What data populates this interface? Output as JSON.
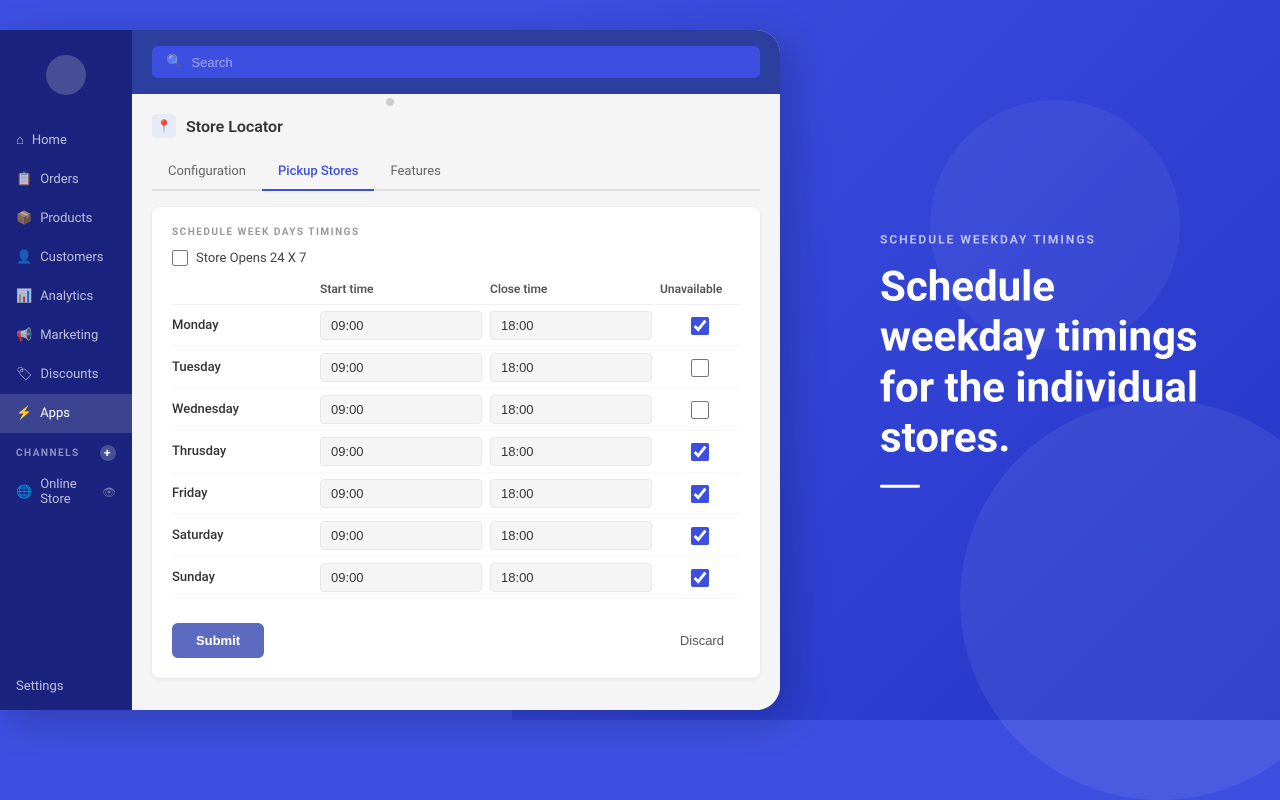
{
  "sidebar": {
    "items": [
      {
        "label": "Home",
        "id": "home"
      },
      {
        "label": "Orders",
        "id": "orders"
      },
      {
        "label": "Products",
        "id": "products"
      },
      {
        "label": "Customers",
        "id": "customers"
      },
      {
        "label": "Analytics",
        "id": "analytics"
      },
      {
        "label": "Marketing",
        "id": "marketing"
      },
      {
        "label": "Discounts",
        "id": "discounts"
      },
      {
        "label": "Apps",
        "id": "apps"
      }
    ],
    "channels_label": "CHANNELS",
    "channel_items": [
      {
        "label": "Online Store",
        "id": "online-store"
      }
    ],
    "settings_label": "Settings"
  },
  "search": {
    "placeholder": "Search"
  },
  "page": {
    "title": "Store Locator",
    "tabs": [
      {
        "label": "Configuration",
        "id": "configuration"
      },
      {
        "label": "Pickup Stores",
        "id": "pickup-stores",
        "active": true
      },
      {
        "label": "Features",
        "id": "features"
      }
    ]
  },
  "form": {
    "section_title": "SCHEDULE WEEK DAYS TIMINGS",
    "checkbox_label": "Store Opens 24 X 7",
    "headers": {
      "day": "",
      "start_time": "Start time",
      "close_time": "Close time",
      "unavailable": "Unavailable"
    },
    "days": [
      {
        "label": "Monday",
        "start": "09:00",
        "close": "18:00",
        "unavailable": true
      },
      {
        "label": "Tuesday",
        "start": "09:00",
        "close": "18:00",
        "unavailable": false
      },
      {
        "label": "Wednesday",
        "start": "09:00",
        "close": "18:00",
        "unavailable": false
      },
      {
        "label": "Thrusday",
        "start": "09:00",
        "close": "18:00",
        "unavailable": true
      },
      {
        "label": "Friday",
        "start": "09:00",
        "close": "18:00",
        "unavailable": true
      },
      {
        "label": "Saturday",
        "start": "09:00",
        "close": "18:00",
        "unavailable": true
      },
      {
        "label": "Sunday",
        "start": "09:00",
        "close": "18:00",
        "unavailable": true
      }
    ],
    "submit_label": "Submit",
    "discard_label": "Discard"
  },
  "right_panel": {
    "subtitle": "SCHEDULE WEEKDAY TIMINGS",
    "title": "Schedule weekday timings for the individual stores."
  }
}
